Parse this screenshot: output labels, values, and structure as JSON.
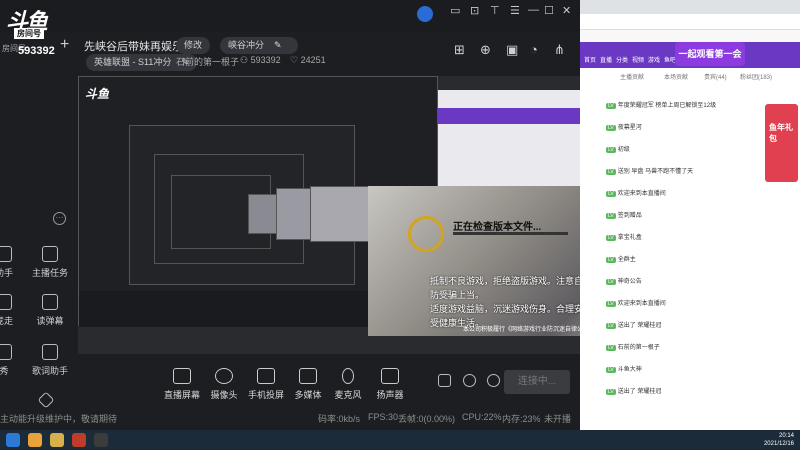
{
  "studio": {
    "logo_text": "斗鱼",
    "logo_sub": "房间号",
    "room_label": "房间号",
    "room_number": "593392",
    "room_title": "先峡谷后带妹再娱乐!",
    "edit_label": "修改",
    "category_pill": "峡谷冲分",
    "game_pill": "英雄联盟 - S11冲分",
    "rank_text": "石前的第一根子",
    "viewer_count": "593392",
    "follower_count": "24251",
    "top_icons": [
      "diamond-avatar",
      "chat-icon",
      "screen-icon",
      "shirt-icon",
      "menu-icon",
      "minimize-icon",
      "maximize-icon",
      "close-icon"
    ],
    "right_icons": [
      "gift-icon",
      "lock-icon",
      "folder-icon",
      "bell-icon",
      "share-icon"
    ]
  },
  "sidebar": {
    "items": [
      {
        "label": "助手",
        "icon": "helper-icon"
      },
      {
        "label": "主播任务",
        "icon": "task-icon"
      },
      {
        "label": "竞走",
        "icon": "walk-icon"
      },
      {
        "label": "读弹幕",
        "icon": "danmu-icon"
      },
      {
        "label": "秀",
        "icon": "show-icon"
      },
      {
        "label": "歌词助手",
        "icon": "lyrics-icon"
      }
    ],
    "more_label": "···"
  },
  "preview": {
    "dialog_message": "正在检查版本文件...",
    "dialog_warning_1": "抵制不良游戏，拒绝盗版游戏。注意自我保护，谨防受骗上当。",
    "dialog_warning_2": "适度游戏益脑，沉迷游戏伤身。合理安排时间，享受健康生活。",
    "dialog_copyright": "本公司积极履行《网络游戏行业防沉迷自律公约》"
  },
  "controls": {
    "items": [
      {
        "label": "直播屏幕",
        "icon": "screen-capture-icon"
      },
      {
        "label": "摄像头",
        "icon": "camera-icon"
      },
      {
        "label": "手机投屏",
        "icon": "phone-cast-icon"
      },
      {
        "label": "多媒体",
        "icon": "media-icon"
      },
      {
        "label": "麦克风",
        "icon": "microphone-icon"
      },
      {
        "label": "扬声器",
        "icon": "speaker-icon"
      }
    ],
    "live_button": "连接中...",
    "status_left": "主动能升级维护中，敬请期待",
    "stat_bitrate": "码率:0kb/s",
    "stat_fps": "FPS:30",
    "stat_drop": "丢帧:0(0.00%)",
    "stat_cpu": "CPU:22%",
    "stat_mem": "内存:23%",
    "stat_state": "未开播"
  },
  "browser": {
    "nav_items": [
      "首页",
      "直播",
      "分类",
      "视频",
      "游戏",
      "鱼吧"
    ],
    "banner_text": "一起观看第一会",
    "tabs": [
      "主播贡献",
      "本场贡献",
      "贵宾(44)",
      "粉丝团(183)"
    ],
    "messages": [
      "年度荣耀冠军 榜单上周已解锁至12级",
      "夜幕星河",
      "初级",
      "送别 早盘 马兽不跑不懂了天",
      "欢迎来到本直播间",
      "签到赠品",
      "拿宝礼盒",
      "全群主",
      "神奇公告",
      "欢迎来到本直播间",
      "送出了 荣耀桂冠",
      "石前的第一根子",
      "斗鱼大神",
      "送出了 荣耀桂冠"
    ],
    "gift_label": "鱼年礼包"
  },
  "taskbar": {
    "time": "20:14",
    "date": "2021/12/16"
  },
  "colors": {
    "studio_bg": "#1d1e22",
    "browser_nav": "#6b38c4",
    "taskbar": "#1c2b3a"
  }
}
